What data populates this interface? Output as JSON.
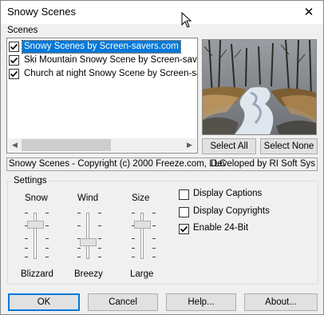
{
  "window": {
    "title": "Snowy Scenes",
    "close_icon": "close-icon"
  },
  "scenes": {
    "label": "Scenes",
    "items": [
      {
        "label": "Snowy Scenes by Screen-savers.com",
        "checked": true,
        "selected": true
      },
      {
        "label": "Ski Mountain Snowy Scene by Screen-savers.",
        "checked": true,
        "selected": false
      },
      {
        "label": "Church at night Snowy Scene by Screen-saver",
        "checked": true,
        "selected": false
      }
    ],
    "scroll_position": 0
  },
  "buttons": {
    "select_all": "Select All",
    "select_none": "Select None",
    "ok": "OK",
    "cancel": "Cancel",
    "help": "Help...",
    "about": "About..."
  },
  "status": {
    "copyright": "Snowy Scenes - Copyright (c) 2000 Freeze.com, LLC",
    "developer": "Developed by RI Soft Sys"
  },
  "settings": {
    "title": "Settings",
    "sliders": [
      {
        "name": "Snow",
        "value_label": "Blizzard",
        "level": 0.2
      },
      {
        "name": "Wind",
        "value_label": "Breezy",
        "level": 0.5
      },
      {
        "name": "Size",
        "value_label": "Large",
        "level": 0.2
      }
    ],
    "options": [
      {
        "label": "Display Captions",
        "checked": false
      },
      {
        "label": "Display Copyrights",
        "checked": false
      },
      {
        "label": "Enable 24-Bit",
        "checked": true
      }
    ]
  },
  "colors": {
    "selection": "#0078d7",
    "default_button_border": "#0078d7"
  }
}
